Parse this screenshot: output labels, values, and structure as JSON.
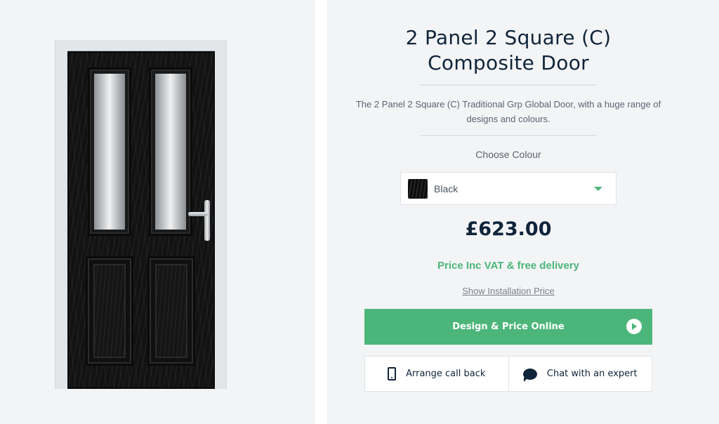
{
  "product": {
    "title_line1": "2 Panel 2 Square (C)",
    "title_line2": "Composite Door",
    "description": "The 2 Panel 2 Square (C) Traditional Grp Global Door, with a huge range of designs and colours.",
    "image_icon": "door-image"
  },
  "colour": {
    "label": "Choose Colour",
    "selected": "Black",
    "swatch_color": "#111111"
  },
  "pricing": {
    "price": "£623.00",
    "note": "Price Inc VAT & free delivery",
    "install_link": "Show Installation Price"
  },
  "cta": {
    "label": "Design & Price Online",
    "icon": "play-circle-icon"
  },
  "actions": {
    "callback_label": "Arrange call back",
    "callback_icon": "phone-icon",
    "chat_label": "Chat with an expert",
    "chat_icon": "chat-bubble-icon"
  },
  "colors": {
    "accent": "#4cb67a",
    "heading": "#10243a",
    "panel_bg": "#f3f4f6"
  }
}
